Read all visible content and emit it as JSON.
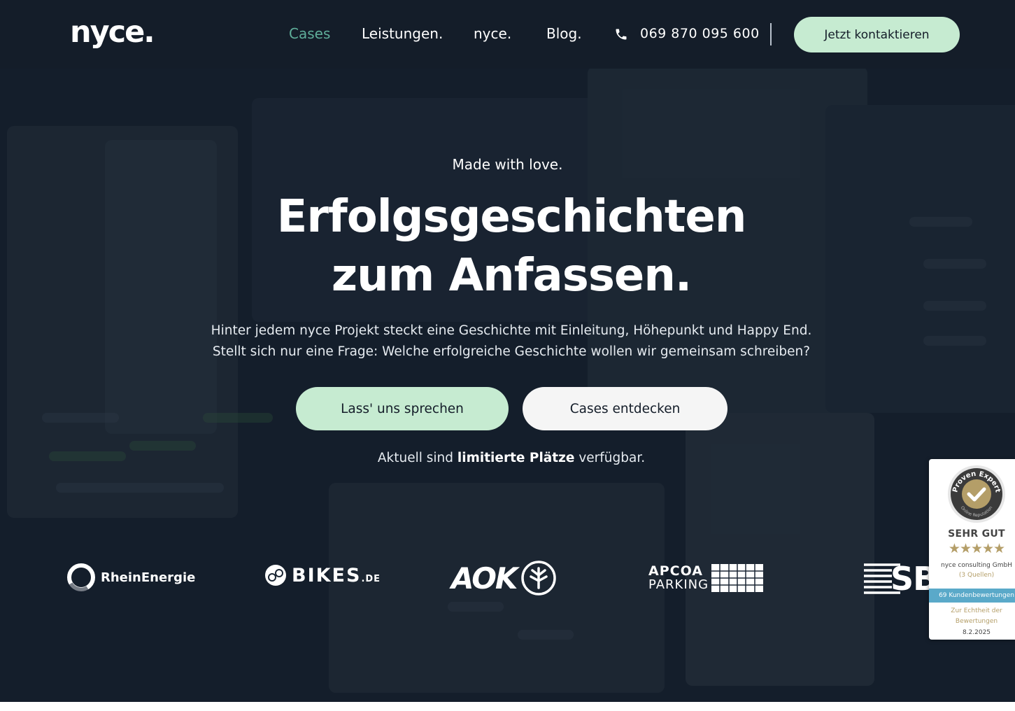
{
  "colors": {
    "background": "#1a2533",
    "header": "#141d29",
    "accent_green": "#c6ebd1",
    "nav_active": "#5fae9a",
    "proven_gold": "#b49e68",
    "proven_blue": "#5aa9c9"
  },
  "header": {
    "logo": "nyce.",
    "nav": [
      {
        "label": "Cases",
        "active": true
      },
      {
        "label": "Leistungen.",
        "active": false
      },
      {
        "label": "nyce.",
        "active": false
      },
      {
        "label": "Blog.",
        "active": false
      }
    ],
    "phone_icon": "phone-icon",
    "phone": "069 870 095 600",
    "cta": "Jetzt kontaktieren"
  },
  "hero": {
    "eyebrow": "Made with love.",
    "title_line1": "Erfolgsgeschichten",
    "title_line2": "zum Anfassen.",
    "subtitle_line1": "Hinter jedem nyce Projekt steckt eine Geschichte mit Einleitung, Höhepunkt und Happy End.",
    "subtitle_line2": "Stellt sich nur eine Frage: Welche erfolgreiche Geschichte wollen wir gemeinsam schreiben?",
    "primary_button": "Lass' uns sprechen",
    "secondary_button": "Cases entdecken",
    "availability_prefix": "Aktuell sind",
    "availability_bold": "limitierte Plätze",
    "availability_suffix": "verfügbar."
  },
  "client_logos": [
    {
      "name": "RheinEnergie",
      "text": "RheinEnergie",
      "icon": "ring-icon"
    },
    {
      "name": "bikes.de",
      "text": "BIKES",
      "suffix": ".DE",
      "icon": "bike-icon"
    },
    {
      "name": "AOK",
      "text": "AOK",
      "icon": "aok-tree-icon"
    },
    {
      "name": "APCOA Parking",
      "text": "APCOA",
      "subtext": "PARKING",
      "icon": "grid-icon"
    },
    {
      "name": "SBB",
      "text": "SBI",
      "icon": "stripes-icon"
    }
  ],
  "proven_expert": {
    "seal_top": "Proven Expert",
    "seal_bottom": "Online Reputation",
    "rating": "SEHR GUT",
    "stars": "★★★★★",
    "company": "nyce consulting GmbH",
    "sources": "(3 Quellen)",
    "reviews": "69 Kundenbewertungen",
    "authenticity_line1": "Zur Echtheit der",
    "authenticity_line2": "Bewertungen",
    "date": "8.2.2025"
  }
}
